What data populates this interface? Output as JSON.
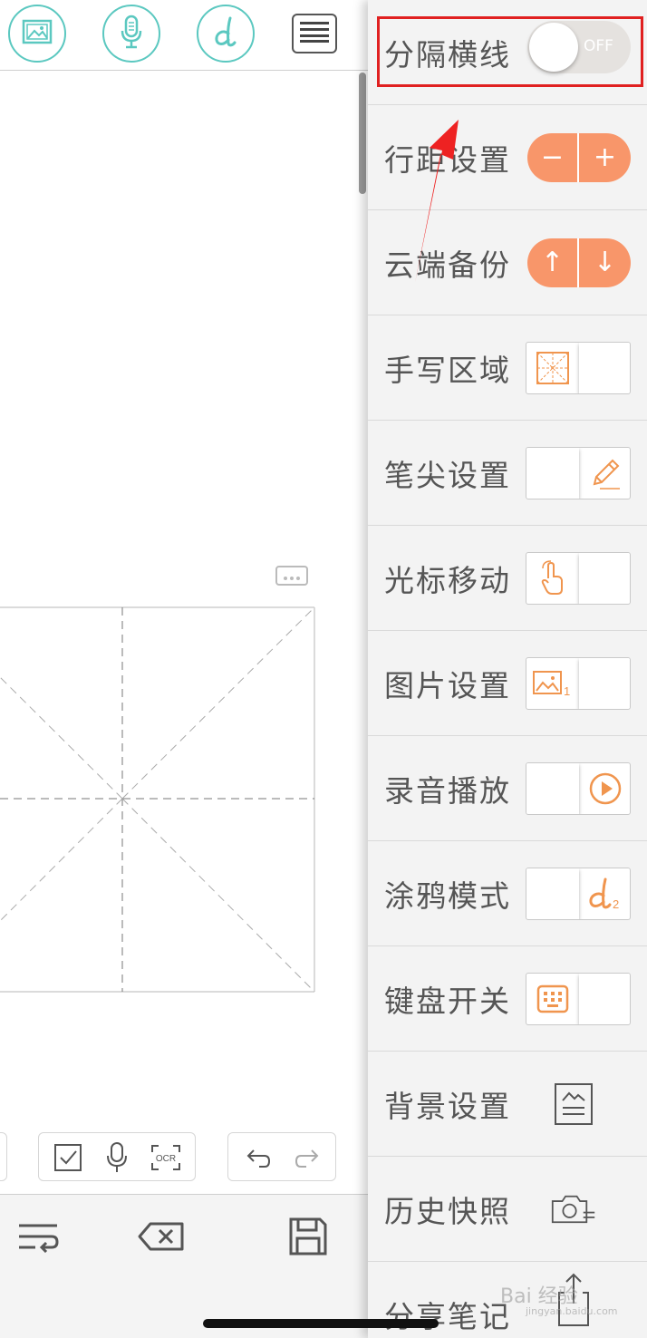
{
  "menu": {
    "separator_label": "分隔横线",
    "separator_state": "OFF",
    "line_spacing_label": "行距设置",
    "line_spacing_minus": "−",
    "line_spacing_plus": "+",
    "cloud_backup_label": "云端备份",
    "cloud_upload": "↑",
    "cloud_download": "↓",
    "handwriting_area_label": "手写区域",
    "pen_tip_label": "笔尖设置",
    "cursor_move_label": "光标移动",
    "image_settings_label": "图片设置",
    "image_badge": "1",
    "recording_label": "录音播放",
    "doodle_label": "涂鸦模式",
    "doodle_badge": "2",
    "keyboard_label": "键盘开关",
    "background_label": "背景设置",
    "history_label": "历史快照",
    "share_label": "分享笔记"
  },
  "toolbar": {
    "ocr_label": "OCR"
  },
  "watermark": {
    "text": "Bai 经验",
    "url": "jingyan.baidu.com"
  },
  "colors": {
    "accent_orange": "#f8966a",
    "teal": "#5bc8c0",
    "highlight_red": "#e02020"
  }
}
